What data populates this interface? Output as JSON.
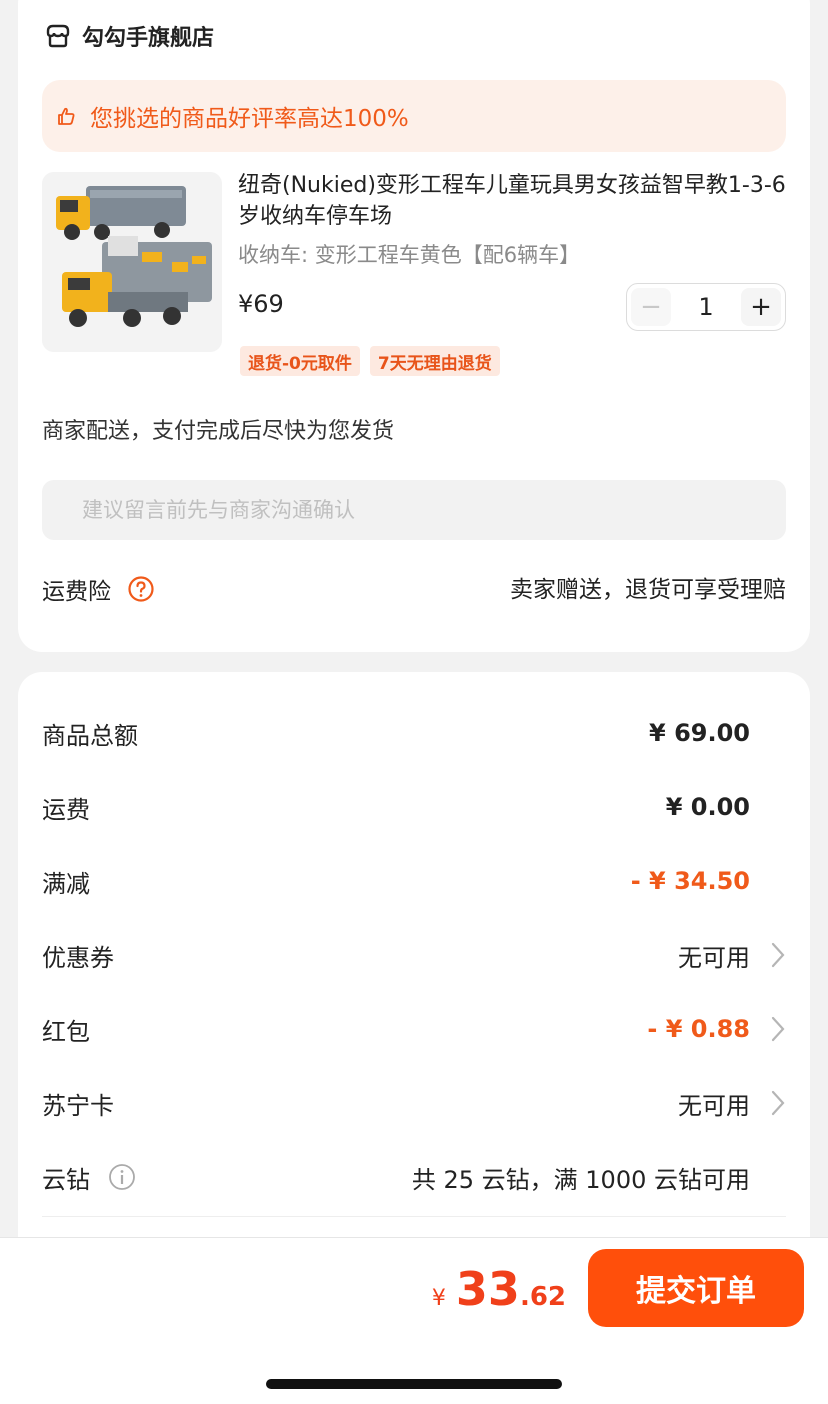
{
  "store": {
    "name": "勾勾手旗舰店",
    "praise": "您挑选的商品好评率高达100%"
  },
  "product": {
    "title": "纽奇(Nukied)变形工程车儿童玩具男女孩益智早教1-3-6岁收纳车停车场",
    "spec": "收纳车: 变形工程车黄色【配6辆车】",
    "price": "¥69",
    "quantity": "1",
    "minus_label": "−",
    "plus_label": "+",
    "tags": [
      "退货-0元取件",
      "7天无理由退货"
    ]
  },
  "delivery": "商家配送，支付完成后尽快为您发货",
  "message": {
    "placeholder": "建议留言前先与商家沟通确认",
    "value": ""
  },
  "insurance": {
    "label": "运费险",
    "value": "卖家赠送，退货可享受理赔"
  },
  "summary": {
    "rows": [
      {
        "label": "商品总额",
        "value": "¥ 69.00"
      },
      {
        "label": "运费",
        "value": "¥ 0.00"
      },
      {
        "label": "满减",
        "value": "- ¥ 34.50"
      },
      {
        "label": "优惠券",
        "value": "无可用"
      },
      {
        "label": "红包",
        "value": "- ¥ 0.88"
      },
      {
        "label": "苏宁卡",
        "value": "无可用"
      },
      {
        "label": "云钻",
        "value": "共 25 云钻，满 1000 云钻可用"
      }
    ]
  },
  "total": {
    "currency": "¥",
    "integer": "33",
    "decimal": ".62"
  },
  "submit_label": "提交订单",
  "colors": {
    "accent": "#ff4f0b",
    "price_red": "#f05a1a",
    "tag_bg": "#fde9e0",
    "praise_bg": "#fdf0e9"
  },
  "icons": [
    "store-icon",
    "thumbs-up-icon",
    "help-icon",
    "info-icon",
    "chevron-right-icon"
  ]
}
